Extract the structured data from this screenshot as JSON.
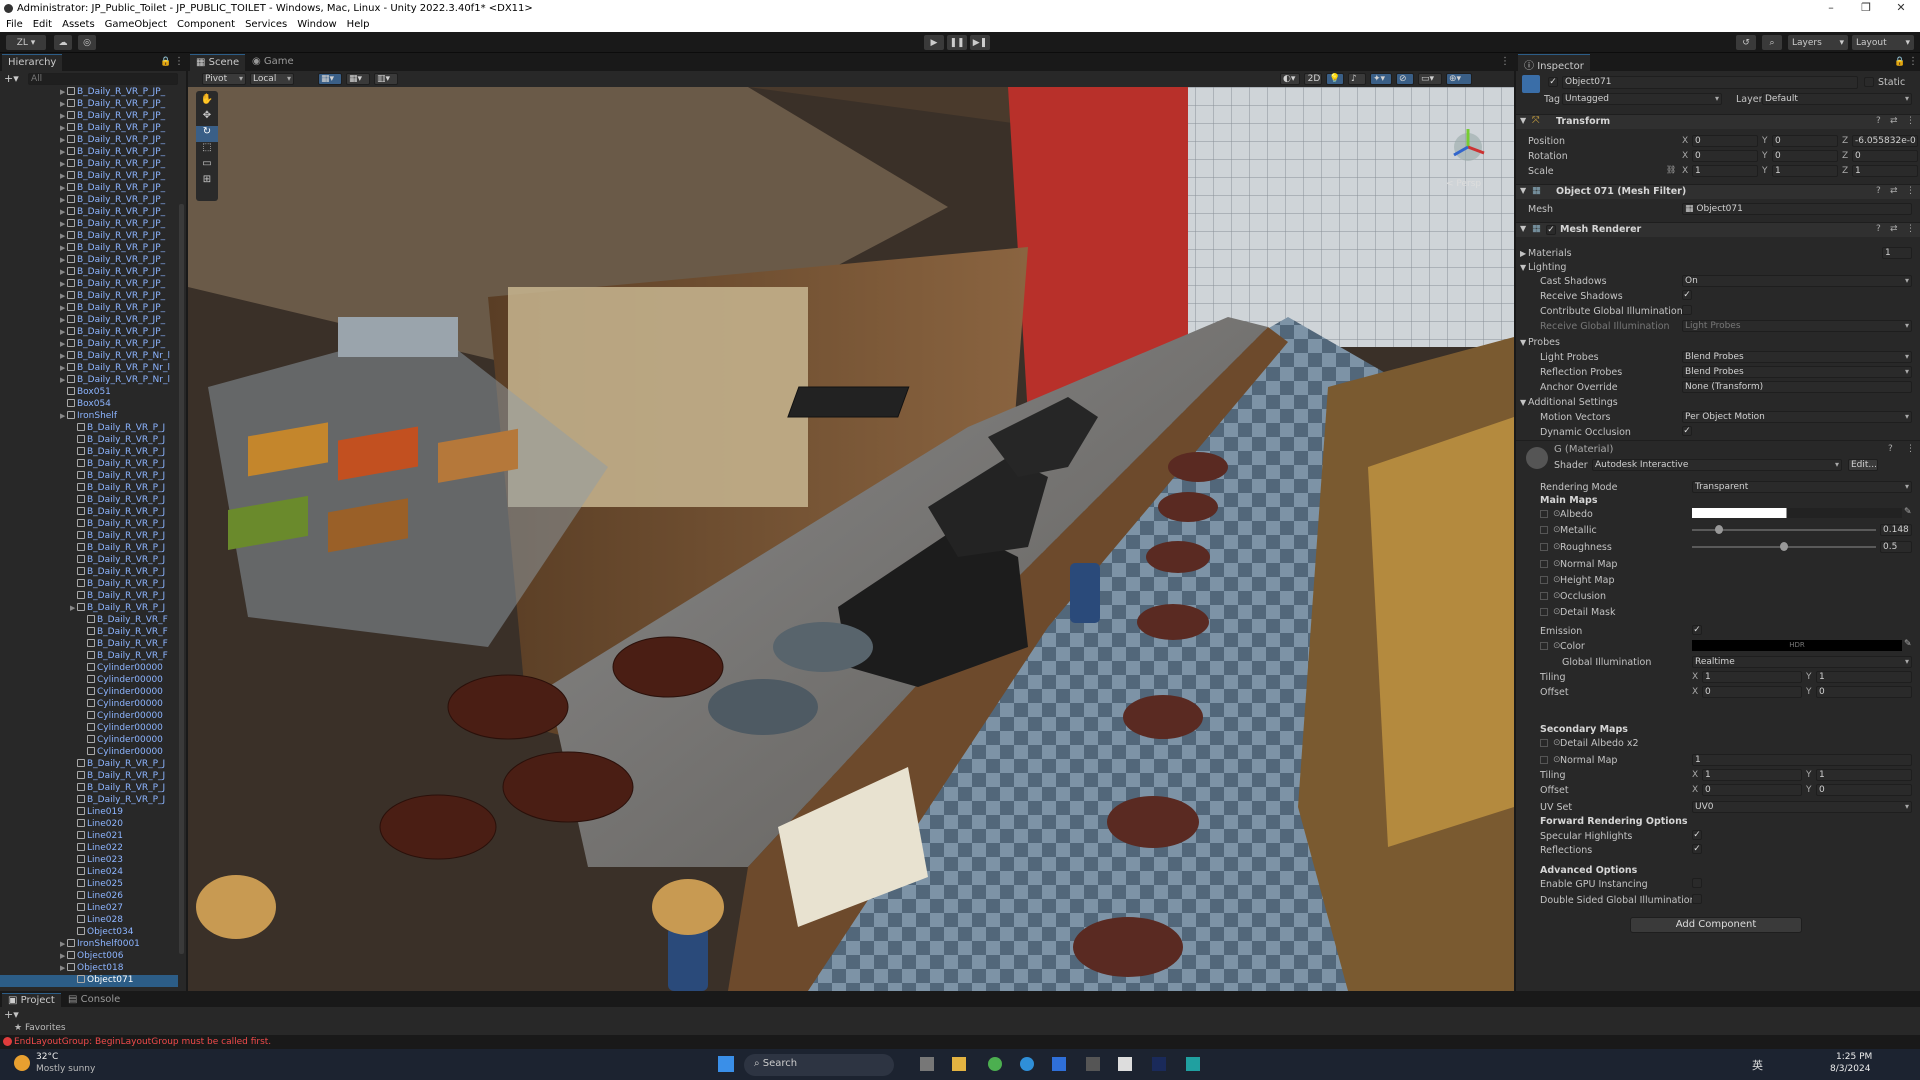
{
  "window": {
    "title": "Administrator: JP_Public_Toilet - JP_PUBLIC_TOILET - Windows, Mac, Linux - Unity 2022.3.40f1* <DX11>"
  },
  "menu": [
    "File",
    "Edit",
    "Assets",
    "GameObject",
    "Component",
    "Services",
    "Window",
    "Help"
  ],
  "toolbar": {
    "account": "ZL",
    "layers": "Layers",
    "layout": "Layout"
  },
  "hierarchy": {
    "tab": "Hierarchy",
    "search_placeholder": "All",
    "items": [
      {
        "label": "B_Daily_R_VR_P_JP_",
        "indent": 1,
        "arrow": true
      },
      {
        "label": "B_Daily_R_VR_P_JP_",
        "indent": 1,
        "arrow": true
      },
      {
        "label": "B_Daily_R_VR_P_JP_",
        "indent": 1,
        "arrow": true
      },
      {
        "label": "B_Daily_R_VR_P_JP_",
        "indent": 1,
        "arrow": true
      },
      {
        "label": "B_Daily_R_VR_P_JP_",
        "indent": 1,
        "arrow": true
      },
      {
        "label": "B_Daily_R_VR_P_JP_",
        "indent": 1,
        "arrow": true
      },
      {
        "label": "B_Daily_R_VR_P_JP_",
        "indent": 1,
        "arrow": true
      },
      {
        "label": "B_Daily_R_VR_P_JP_",
        "indent": 1,
        "arrow": true
      },
      {
        "label": "B_Daily_R_VR_P_JP_",
        "indent": 1,
        "arrow": true
      },
      {
        "label": "B_Daily_R_VR_P_JP_",
        "indent": 1,
        "arrow": true
      },
      {
        "label": "B_Daily_R_VR_P_JP_",
        "indent": 1,
        "arrow": true
      },
      {
        "label": "B_Daily_R_VR_P_JP_",
        "indent": 1,
        "arrow": true
      },
      {
        "label": "B_Daily_R_VR_P_JP_",
        "indent": 1,
        "arrow": true
      },
      {
        "label": "B_Daily_R_VR_P_JP_",
        "indent": 1,
        "arrow": true
      },
      {
        "label": "B_Daily_R_VR_P_JP_",
        "indent": 1,
        "arrow": true
      },
      {
        "label": "B_Daily_R_VR_P_JP_",
        "indent": 1,
        "arrow": true
      },
      {
        "label": "B_Daily_R_VR_P_JP_",
        "indent": 1,
        "arrow": true
      },
      {
        "label": "B_Daily_R_VR_P_JP_",
        "indent": 1,
        "arrow": true
      },
      {
        "label": "B_Daily_R_VR_P_JP_",
        "indent": 1,
        "arrow": true
      },
      {
        "label": "B_Daily_R_VR_P_JP_",
        "indent": 1,
        "arrow": true
      },
      {
        "label": "B_Daily_R_VR_P_JP_",
        "indent": 1,
        "arrow": true
      },
      {
        "label": "B_Daily_R_VR_P_JP_",
        "indent": 1,
        "arrow": true
      },
      {
        "label": "B_Daily_R_VR_P_Nr_l",
        "indent": 1,
        "arrow": true
      },
      {
        "label": "B_Daily_R_VR_P_Nr_l",
        "indent": 1,
        "arrow": true
      },
      {
        "label": "B_Daily_R_VR_P_Nr_l",
        "indent": 1,
        "arrow": true
      },
      {
        "label": "Box051",
        "indent": 1,
        "arrow": false
      },
      {
        "label": "Box054",
        "indent": 1,
        "arrow": false
      },
      {
        "label": "IronShelf",
        "indent": 1,
        "arrow": true
      },
      {
        "label": "B_Daily_R_VR_P_J",
        "indent": 2,
        "arrow": false
      },
      {
        "label": "B_Daily_R_VR_P_J",
        "indent": 2,
        "arrow": false
      },
      {
        "label": "B_Daily_R_VR_P_J",
        "indent": 2,
        "arrow": false
      },
      {
        "label": "B_Daily_R_VR_P_J",
        "indent": 2,
        "arrow": false
      },
      {
        "label": "B_Daily_R_VR_P_J",
        "indent": 2,
        "arrow": false
      },
      {
        "label": "B_Daily_R_VR_P_J",
        "indent": 2,
        "arrow": false
      },
      {
        "label": "B_Daily_R_VR_P_J",
        "indent": 2,
        "arrow": false
      },
      {
        "label": "B_Daily_R_VR_P_J",
        "indent": 2,
        "arrow": false
      },
      {
        "label": "B_Daily_R_VR_P_J",
        "indent": 2,
        "arrow": false
      },
      {
        "label": "B_Daily_R_VR_P_J",
        "indent": 2,
        "arrow": false
      },
      {
        "label": "B_Daily_R_VR_P_J",
        "indent": 2,
        "arrow": false
      },
      {
        "label": "B_Daily_R_VR_P_J",
        "indent": 2,
        "arrow": false
      },
      {
        "label": "B_Daily_R_VR_P_J",
        "indent": 2,
        "arrow": false
      },
      {
        "label": "B_Daily_R_VR_P_J",
        "indent": 2,
        "arrow": false
      },
      {
        "label": "B_Daily_R_VR_P_J",
        "indent": 2,
        "arrow": false
      },
      {
        "label": "B_Daily_R_VR_P_J",
        "indent": 2,
        "arrow": true
      },
      {
        "label": "B_Daily_R_VR_F",
        "indent": 3,
        "arrow": false
      },
      {
        "label": "B_Daily_R_VR_F",
        "indent": 3,
        "arrow": false
      },
      {
        "label": "B_Daily_R_VR_F",
        "indent": 3,
        "arrow": false
      },
      {
        "label": "B_Daily_R_VR_F",
        "indent": 3,
        "arrow": false
      },
      {
        "label": "Cylinder00000",
        "indent": 3,
        "arrow": false
      },
      {
        "label": "Cylinder00000",
        "indent": 3,
        "arrow": false
      },
      {
        "label": "Cylinder00000",
        "indent": 3,
        "arrow": false
      },
      {
        "label": "Cylinder00000",
        "indent": 3,
        "arrow": false
      },
      {
        "label": "Cylinder00000",
        "indent": 3,
        "arrow": false
      },
      {
        "label": "Cylinder00000",
        "indent": 3,
        "arrow": false
      },
      {
        "label": "Cylinder00000",
        "indent": 3,
        "arrow": false
      },
      {
        "label": "Cylinder00000",
        "indent": 3,
        "arrow": false
      },
      {
        "label": "B_Daily_R_VR_P_J",
        "indent": 2,
        "arrow": false
      },
      {
        "label": "B_Daily_R_VR_P_J",
        "indent": 2,
        "arrow": false
      },
      {
        "label": "B_Daily_R_VR_P_J",
        "indent": 2,
        "arrow": false
      },
      {
        "label": "B_Daily_R_VR_P_J",
        "indent": 2,
        "arrow": false
      },
      {
        "label": "Line019",
        "indent": 2,
        "arrow": false
      },
      {
        "label": "Line020",
        "indent": 2,
        "arrow": false
      },
      {
        "label": "Line021",
        "indent": 2,
        "arrow": false
      },
      {
        "label": "Line022",
        "indent": 2,
        "arrow": false
      },
      {
        "label": "Line023",
        "indent": 2,
        "arrow": false
      },
      {
        "label": "Line024",
        "indent": 2,
        "arrow": false
      },
      {
        "label": "Line025",
        "indent": 2,
        "arrow": false
      },
      {
        "label": "Line026",
        "indent": 2,
        "arrow": false
      },
      {
        "label": "Line027",
        "indent": 2,
        "arrow": false
      },
      {
        "label": "Line028",
        "indent": 2,
        "arrow": false
      },
      {
        "label": "Object034",
        "indent": 2,
        "arrow": false
      },
      {
        "label": "IronShelf0001",
        "indent": 1,
        "arrow": true
      },
      {
        "label": "Object006",
        "indent": 1,
        "arrow": true
      },
      {
        "label": "Object018",
        "indent": 1,
        "arrow": true
      },
      {
        "label": "Object071",
        "indent": 2,
        "arrow": false,
        "selected": true
      }
    ]
  },
  "scene": {
    "tabs": [
      "Scene",
      "Game"
    ],
    "pivot": "Pivot",
    "local": "Local",
    "mode2d": "2D",
    "persp": "< Persp"
  },
  "inspector": {
    "tab": "Inspector",
    "object_name": "Object071",
    "static": "Static",
    "tag_label": "Tag",
    "tag": "Untagged",
    "layer_label": "Layer",
    "layer": "Default",
    "transform": {
      "title": "Transform",
      "position_label": "Position",
      "rotation_label": "Rotation",
      "scale_label": "Scale",
      "position": [
        "0",
        "0",
        "-6.055832e-0"
      ],
      "rotation": [
        "0",
        "0",
        "0"
      ],
      "scale": [
        "1",
        "1",
        "1"
      ]
    },
    "meshfilter": {
      "title": "Object 071 (Mesh Filter)",
      "mesh_label": "Mesh",
      "mesh": "Object071"
    },
    "meshrenderer": {
      "title": "Mesh Renderer",
      "materials": "Materials",
      "materials_count": "1",
      "lighting": "Lighting",
      "cast_shadows_label": "Cast Shadows",
      "cast_shadows": "On",
      "receive_shadows": "Receive Shadows",
      "contribute_gi": "Contribute Global Illumination",
      "receive_gi_label": "Receive Global Illumination",
      "receive_gi": "Light Probes",
      "probes": "Probes",
      "light_probes_label": "Light Probes",
      "light_probes": "Blend Probes",
      "reflection_probes_label": "Reflection Probes",
      "reflection_probes": "Blend Probes",
      "anchor_label": "Anchor Override",
      "anchor": "None (Transform)",
      "additional": "Additional Settings",
      "motion_label": "Motion Vectors",
      "motion": "Per Object Motion",
      "dynamic_occlusion": "Dynamic Occlusion"
    },
    "material": {
      "name": "G (Material)",
      "shader_label": "Shader",
      "shader": "Autodesk Interactive",
      "edit": "Edit...",
      "rendering_mode_label": "Rendering Mode",
      "rendering_mode": "Transparent",
      "main_maps": "Main Maps",
      "albedo": "Albedo",
      "metallic": "Metallic",
      "metallic_value": "0.148",
      "metallic_fraction": 0.148,
      "roughness": "Roughness",
      "roughness_value": "0.5",
      "roughness_fraction": 0.5,
      "normal_map": "Normal Map",
      "height_map": "Height Map",
      "occlusion": "Occlusion",
      "detail_mask": "Detail Mask",
      "emission": "Emission",
      "color": "Color",
      "hdr": "HDR",
      "global_illumination_label": "Global Illumination",
      "global_illumination": "Realtime",
      "tiling": "Tiling",
      "offset": "Offset",
      "tiling_xy": [
        "1",
        "1"
      ],
      "offset_xy": [
        "0",
        "0"
      ],
      "secondary_maps": "Secondary Maps",
      "detail_albedo": "Detail Albedo x2",
      "sec_normal_map": "Normal Map",
      "sec_normal_value": "1",
      "sec_tiling_xy": [
        "1",
        "1"
      ],
      "sec_offset_xy": [
        "0",
        "0"
      ],
      "uv_set_label": "UV Set",
      "uv_set": "UV0",
      "forward": "Forward Rendering Options",
      "specular": "Specular Highlights",
      "reflections": "Reflections",
      "advanced": "Advanced Options",
      "gpu_instancing": "Enable GPU Instancing",
      "double_sided": "Double Sided Global Illumination"
    },
    "add_component": "Add Component"
  },
  "bottom": {
    "tabs": [
      "Project",
      "Console"
    ],
    "favorites": "Favorites"
  },
  "status": {
    "error": "EndLayoutGroup: BeginLayoutGroup must be called first."
  },
  "taskbar": {
    "temp": "32°C",
    "weather": "Mostly sunny",
    "search": "Search",
    "time": "1:25 PM",
    "date": "8/3/2024",
    "lang": "英"
  }
}
